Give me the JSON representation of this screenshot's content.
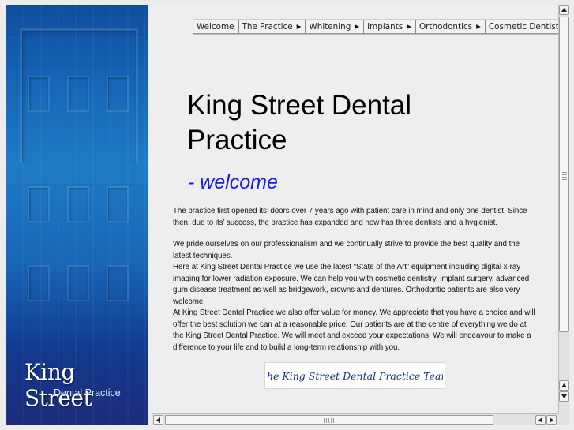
{
  "brand": {
    "name": "King Street",
    "sub": "Dental Practice"
  },
  "menu": {
    "items": [
      {
        "label": "Welcome",
        "has_submenu": false
      },
      {
        "label": "The Practice",
        "has_submenu": true
      },
      {
        "label": "Whitening",
        "has_submenu": true
      },
      {
        "label": "Implants",
        "has_submenu": true
      },
      {
        "label": "Orthodontics",
        "has_submenu": true
      },
      {
        "label": "Cosmetic Dentistry",
        "has_submenu": false
      }
    ]
  },
  "heading": {
    "title": "King Street Dental Practice",
    "subtitle": "- welcome"
  },
  "body": {
    "para1": "The practice first opened its’ doors over 7 years ago with patient care in mind and only one dentist. Since then, due to its’ success, the practice has expanded and now has three dentists and a hygienist.",
    "para2_lines": [
      "We pride ourselves on our professionalism and we continually strive to provide the best quality and the latest techniques.",
      "Here at King Street Dental Practice we use the latest “State of the Art” equipment including digital x-ray imaging for lower radiation exposure. We can help you with cosmetic dentistry, implant surgery, advanced gum disease treatment as well as bridgework, crowns and dentures. Orthodontic patients are also very welcome.",
      "At King Street Dental Practice we also offer value for money. We appreciate that you have a choice and will offer the best solution we can at a reasonable price. Our patients are at the centre of everything we do at the King Street Dental Practice. We will meet and exceed your expectations. We will endeavour to make a difference to your life and to build a long-term relationship with you."
    ]
  },
  "team_banner": {
    "text": "The King Street Dental Practice Team",
    "color": "#1c2f7a"
  },
  "colors": {
    "banner_top": "#0f4d9c",
    "banner_bottom": "#1d2c7a",
    "subtitle": "#1a1adf",
    "page_bg": "#eeeeee"
  }
}
